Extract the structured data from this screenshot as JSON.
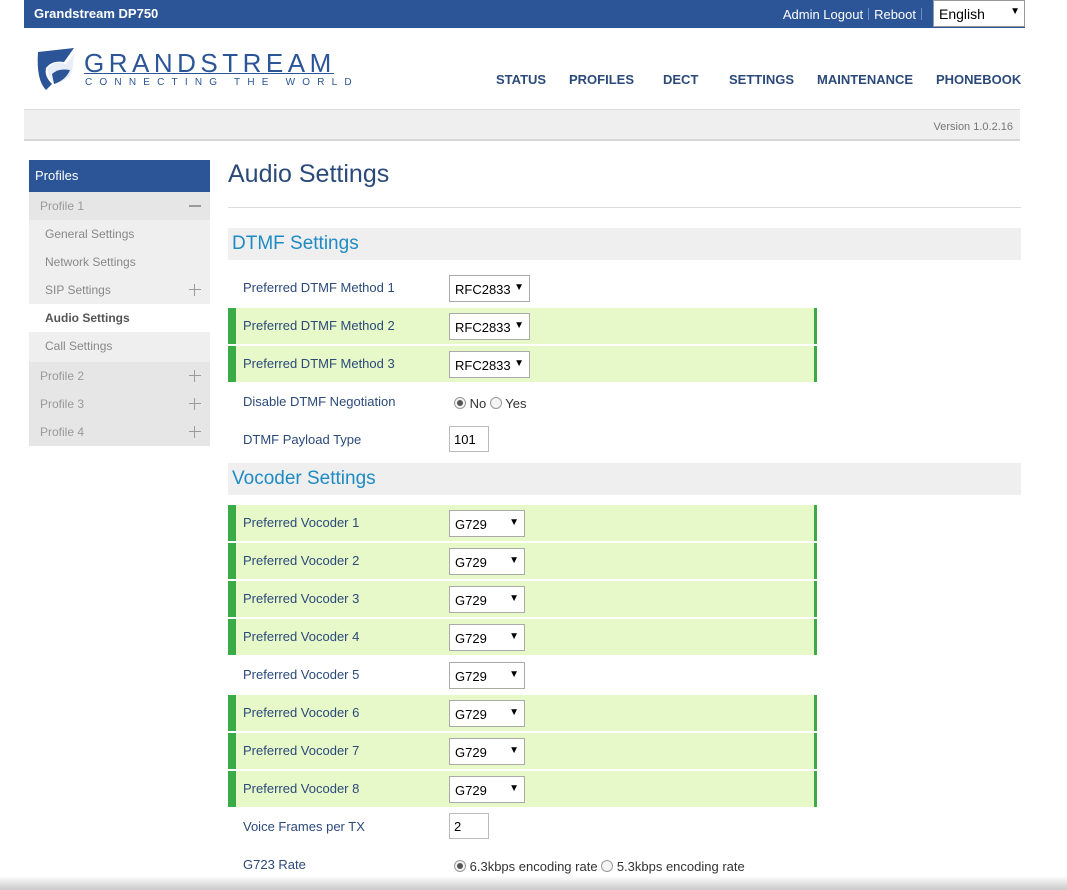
{
  "topbar": {
    "title": "Grandstream DP750",
    "admin_logout": "Admin Logout",
    "reboot": "Reboot",
    "language": "English"
  },
  "header": {
    "brand": "GRANDSTREAM",
    "tagline": "CONNECTING THE WORLD",
    "nav": [
      "STATUS",
      "PROFILES",
      "DECT",
      "SETTINGS",
      "MAINTENANCE",
      "PHONEBOOK"
    ],
    "version": "Version 1.0.2.16"
  },
  "sidebar": {
    "heading": "Profiles",
    "profile1": "Profile 1",
    "items": [
      "General Settings",
      "Network Settings",
      "SIP Settings",
      "Audio Settings",
      "Call Settings"
    ],
    "profile2": "Profile 2",
    "profile3": "Profile 3",
    "profile4": "Profile 4"
  },
  "main": {
    "title": "Audio Settings",
    "dtmf": {
      "heading": "DTMF Settings",
      "method1_label": "Preferred DTMF Method 1",
      "method1_value": "RFC2833",
      "method2_label": "Preferred DTMF Method 2",
      "method2_value": "RFC2833",
      "method3_label": "Preferred DTMF Method 3",
      "method3_value": "RFC2833",
      "negotiation_label": "Disable DTMF Negotiation",
      "negotiation_no": "No",
      "negotiation_yes": "Yes",
      "payload_label": "DTMF Payload Type",
      "payload_value": "101"
    },
    "vocoder": {
      "heading": "Vocoder Settings",
      "rows": [
        {
          "label": "Preferred Vocoder 1",
          "value": "G729"
        },
        {
          "label": "Preferred Vocoder 2",
          "value": "G729"
        },
        {
          "label": "Preferred Vocoder 3",
          "value": "G729"
        },
        {
          "label": "Preferred Vocoder 4",
          "value": "G729"
        },
        {
          "label": "Preferred Vocoder 5",
          "value": "G729"
        },
        {
          "label": "Preferred Vocoder 6",
          "value": "G729"
        },
        {
          "label": "Preferred Vocoder 7",
          "value": "G729"
        },
        {
          "label": "Preferred Vocoder 8",
          "value": "G729"
        }
      ],
      "frames_label": "Voice Frames per TX",
      "frames_value": "2",
      "g723_label": "G723 Rate",
      "g723_opt1": "6.3kbps encoding rate",
      "g723_opt2": "5.3kbps encoding rate"
    }
  },
  "colors": {
    "brand_blue": "#2b5597",
    "highlight_bg": "#e7f8c9",
    "highlight_border": "#3bab48",
    "section_text": "#1e8bc3"
  }
}
